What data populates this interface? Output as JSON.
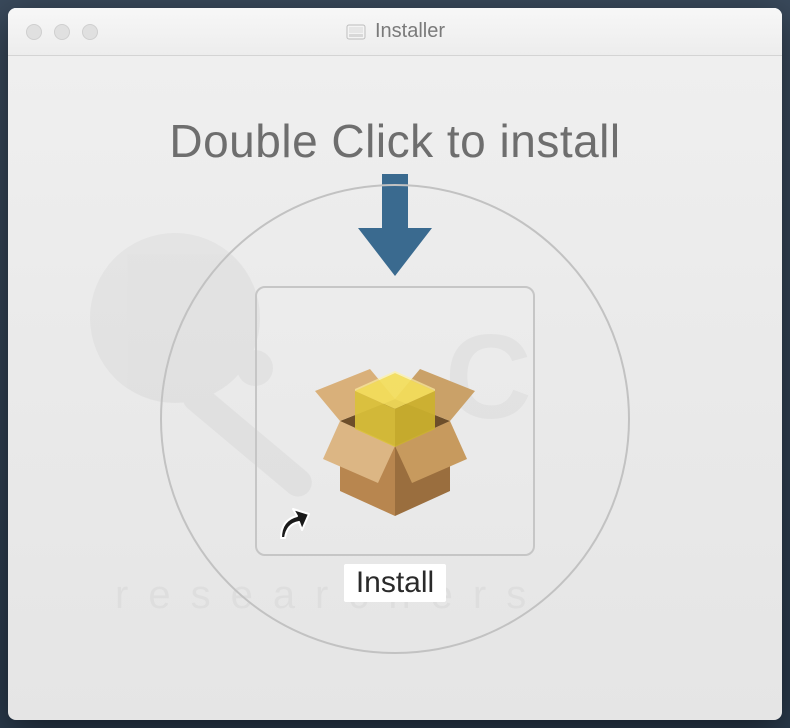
{
  "window": {
    "title": "Installer"
  },
  "content": {
    "instruction": "Double Click to install",
    "install_label": "Install"
  },
  "colors": {
    "arrow": "#3a6a8f",
    "box_side": "#b8864f",
    "box_side_dark": "#9a6e3e",
    "box_flap": "#d9b07a",
    "box_inner": "#6d4e2a",
    "cube_top": "#f0d94a",
    "cube_side": "#dbc23a"
  }
}
